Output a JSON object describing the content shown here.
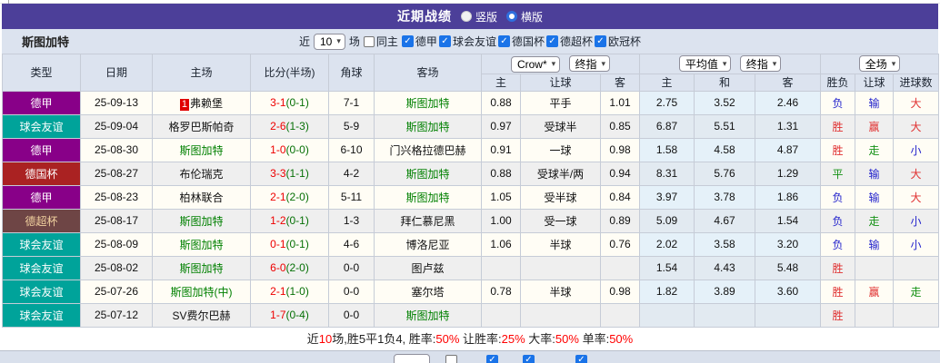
{
  "icons": {
    "dropdown_arrow": "▾",
    "checkmark": "✓"
  },
  "title_bar": {
    "title": "近期战绩",
    "radio_vertical_label": "竖版",
    "radio_horizontal_label": "横版"
  },
  "filter_bar": {
    "team_name": "斯图加特",
    "recent_label": "近",
    "recent_count": "10",
    "matches_label": "场",
    "same_home_label": "同主",
    "league_filters": [
      "德甲",
      "球会友谊",
      "德国杯",
      "德超杯",
      "欧冠杯"
    ]
  },
  "table": {
    "columns": [
      "类型",
      "日期",
      "主场",
      "比分(半场)",
      "角球",
      "客场"
    ],
    "odds_group": {
      "select_company": "Crow*",
      "select_time": "终指",
      "sub": [
        "主",
        "让球",
        "客"
      ]
    },
    "avg_group": {
      "select_type": "平均值",
      "select_time": "终指",
      "sub": [
        "主",
        "和",
        "客"
      ]
    },
    "result_group": {
      "select_scope": "全场",
      "sub": [
        "胜负",
        "让球",
        "进球数"
      ]
    },
    "league_styles": {
      "德甲": {
        "bg": "#880088",
        "fg": "#ffffff"
      },
      "球会友谊": {
        "bg": "#00a39a",
        "fg": "#ffffff"
      },
      "德国杯": {
        "bg": "#aa2222",
        "fg": "#ffffff"
      },
      "德超杯": {
        "bg": "#6e4545",
        "fg": "#f2d2a0"
      }
    },
    "rows": [
      {
        "league": "德甲",
        "date": "25-09-13",
        "badge": "1",
        "home": "弗赖堡",
        "home_green": false,
        "score_ft": "3-1",
        "score_ht": "(0-1)",
        "corner": "7-1",
        "away": "斯图加特",
        "away_green": true,
        "odds": [
          "0.88",
          "平手",
          "1.01"
        ],
        "avg": [
          "2.75",
          "3.52",
          "2.46"
        ],
        "results": [
          {
            "t": "负",
            "c": "b"
          },
          {
            "t": "输",
            "c": "b"
          },
          {
            "t": "大",
            "c": "r"
          }
        ]
      },
      {
        "league": "球会友谊",
        "date": "25-09-04",
        "badge": "",
        "home": "格罗巴斯帕奇",
        "home_green": false,
        "score_ft": "2-6",
        "score_ht": "(1-3)",
        "corner": "5-9",
        "away": "斯图加特",
        "away_green": true,
        "odds": [
          "0.97",
          "受球半",
          "0.85"
        ],
        "avg": [
          "6.87",
          "5.51",
          "1.31"
        ],
        "results": [
          {
            "t": "胜",
            "c": "r"
          },
          {
            "t": "赢",
            "c": "r"
          },
          {
            "t": "大",
            "c": "r"
          }
        ]
      },
      {
        "league": "德甲",
        "date": "25-08-30",
        "badge": "",
        "home": "斯图加特",
        "home_green": true,
        "score_ft": "1-0",
        "score_ht": "(0-0)",
        "corner": "6-10",
        "away": "门兴格拉德巴赫",
        "away_green": false,
        "odds": [
          "0.91",
          "一球",
          "0.98"
        ],
        "avg": [
          "1.58",
          "4.58",
          "4.87"
        ],
        "results": [
          {
            "t": "胜",
            "c": "r"
          },
          {
            "t": "走",
            "c": "g"
          },
          {
            "t": "小",
            "c": "b"
          }
        ]
      },
      {
        "league": "德国杯",
        "date": "25-08-27",
        "badge": "",
        "home": "布伦瑞克",
        "home_green": false,
        "score_ft": "3-3",
        "score_ht": "(1-1)",
        "corner": "4-2",
        "away": "斯图加特",
        "away_green": true,
        "odds": [
          "0.88",
          "受球半/两",
          "0.94"
        ],
        "avg": [
          "8.31",
          "5.76",
          "1.29"
        ],
        "results": [
          {
            "t": "平",
            "c": "g"
          },
          {
            "t": "输",
            "c": "b"
          },
          {
            "t": "大",
            "c": "r"
          }
        ]
      },
      {
        "league": "德甲",
        "date": "25-08-23",
        "badge": "",
        "home": "柏林联合",
        "home_green": false,
        "score_ft": "2-1",
        "score_ht": "(2-0)",
        "corner": "5-11",
        "away": "斯图加特",
        "away_green": true,
        "odds": [
          "1.05",
          "受半球",
          "0.84"
        ],
        "avg": [
          "3.97",
          "3.78",
          "1.86"
        ],
        "results": [
          {
            "t": "负",
            "c": "b"
          },
          {
            "t": "输",
            "c": "b"
          },
          {
            "t": "大",
            "c": "r"
          }
        ]
      },
      {
        "league": "德超杯",
        "date": "25-08-17",
        "badge": "",
        "home": "斯图加特",
        "home_green": true,
        "score_ft": "1-2",
        "score_ht": "(0-1)",
        "corner": "1-3",
        "away": "拜仁慕尼黑",
        "away_green": false,
        "odds": [
          "1.00",
          "受一球",
          "0.89"
        ],
        "avg": [
          "5.09",
          "4.67",
          "1.54"
        ],
        "results": [
          {
            "t": "负",
            "c": "b"
          },
          {
            "t": "走",
            "c": "g"
          },
          {
            "t": "小",
            "c": "b"
          }
        ]
      },
      {
        "league": "球会友谊",
        "date": "25-08-09",
        "badge": "",
        "home": "斯图加特",
        "home_green": true,
        "score_ft": "0-1",
        "score_ht": "(0-1)",
        "corner": "4-6",
        "away": "博洛尼亚",
        "away_green": false,
        "odds": [
          "1.06",
          "半球",
          "0.76"
        ],
        "avg": [
          "2.02",
          "3.58",
          "3.20"
        ],
        "results": [
          {
            "t": "负",
            "c": "b"
          },
          {
            "t": "输",
            "c": "b"
          },
          {
            "t": "小",
            "c": "b"
          }
        ]
      },
      {
        "league": "球会友谊",
        "date": "25-08-02",
        "badge": "",
        "home": "斯图加特",
        "home_green": true,
        "score_ft": "6-0",
        "score_ht": "(2-0)",
        "corner": "0-0",
        "away": "图卢兹",
        "away_green": false,
        "odds": [
          "",
          "",
          ""
        ],
        "avg": [
          "1.54",
          "4.43",
          "5.48"
        ],
        "results": [
          {
            "t": "胜",
            "c": "r"
          },
          {
            "t": "",
            "c": "k"
          },
          {
            "t": "",
            "c": "k"
          }
        ]
      },
      {
        "league": "球会友谊",
        "date": "25-07-26",
        "badge": "",
        "home": "斯图加特(中)",
        "home_green": true,
        "score_ft": "2-1",
        "score_ht": "(1-0)",
        "corner": "0-0",
        "away": "塞尔塔",
        "away_green": false,
        "odds": [
          "0.78",
          "半球",
          "0.98"
        ],
        "avg": [
          "1.82",
          "3.89",
          "3.60"
        ],
        "results": [
          {
            "t": "胜",
            "c": "r"
          },
          {
            "t": "赢",
            "c": "r"
          },
          {
            "t": "走",
            "c": "g"
          }
        ]
      },
      {
        "league": "球会友谊",
        "date": "25-07-12",
        "badge": "",
        "home": "SV费尔巴赫",
        "home_green": false,
        "score_ft": "1-7",
        "score_ht": "(0-4)",
        "corner": "0-0",
        "away": "斯图加特",
        "away_green": true,
        "odds": [
          "",
          "",
          ""
        ],
        "avg": [
          "",
          "",
          ""
        ],
        "results": [
          {
            "t": "胜",
            "c": "r"
          },
          {
            "t": "",
            "c": "k"
          },
          {
            "t": "",
            "c": "k"
          }
        ]
      }
    ]
  },
  "footer": {
    "segments": [
      {
        "t": "近",
        "c": "k"
      },
      {
        "t": "10",
        "c": "r"
      },
      {
        "t": "场,胜5平1负4, 胜率:",
        "c": "k"
      },
      {
        "t": "50%",
        "c": "r"
      },
      {
        "t": " 让胜率:",
        "c": "k"
      },
      {
        "t": "25%",
        "c": "r"
      },
      {
        "t": " 大率:",
        "c": "k"
      },
      {
        "t": "50%",
        "c": "r"
      },
      {
        "t": " 单率:",
        "c": "k"
      },
      {
        "t": "50%",
        "c": "r"
      }
    ]
  },
  "colors": {
    "title_bar_bg": "#4c3f99",
    "panel_bg": "#dce3ef",
    "accent_blue": "#1a73e8",
    "score_red": "#ee0000",
    "score_half_green": "#067006",
    "team_green": "#008000",
    "result_red": "#e03030",
    "result_blue": "#2424cc",
    "result_green": "#149114"
  }
}
